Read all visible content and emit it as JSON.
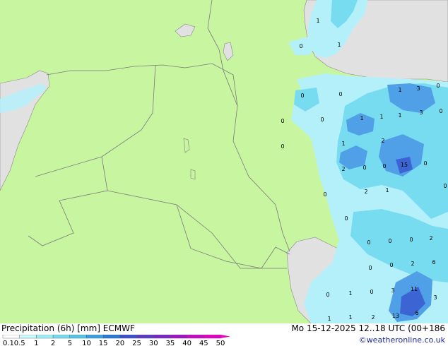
{
  "title": "Precipitation (6h) [mm] ECMWF",
  "run_info": "Mo 15-12-2025 12..18 UTC (00+186",
  "credit": "©weatheronline.co.uk",
  "colors": {
    "land": "#c8f5a0",
    "sea": "#e1e1e1",
    "border": "#7a7a7a",
    "precip_light": "#b4f0fa",
    "precip_mid": "#78dcf0",
    "precip_heavy": "#4fa0e6",
    "precip_max": "#3c64d2"
  },
  "legend": {
    "ticks": [
      "0.1",
      "0.5",
      "1",
      "2",
      "5",
      "10",
      "15",
      "20",
      "25",
      "30",
      "35",
      "40",
      "45",
      "50"
    ],
    "colors": [
      "#ffffff",
      "#c8faff",
      "#a0f0fa",
      "#78dcf0",
      "#50c8e6",
      "#3ca0e6",
      "#2878dc",
      "#3c50d2",
      "#5a3cc8",
      "#7828c8",
      "#a014c8",
      "#c80ac8",
      "#e600c8"
    ]
  },
  "precip_labels": [
    "1",
    "1",
    "0",
    "0",
    "0",
    "1",
    "3",
    "0",
    "0",
    "0",
    "1",
    "1",
    "1",
    "3",
    "0",
    "0",
    "1",
    "2",
    "2",
    "0",
    "0",
    "15",
    "0",
    "0",
    "2",
    "1",
    "0",
    "0",
    "0",
    "0",
    "0",
    "2",
    "0",
    "0",
    "2",
    "6",
    "0",
    "1",
    "0",
    "3",
    "11",
    "3",
    "1",
    "1",
    "2",
    "13",
    "6"
  ]
}
